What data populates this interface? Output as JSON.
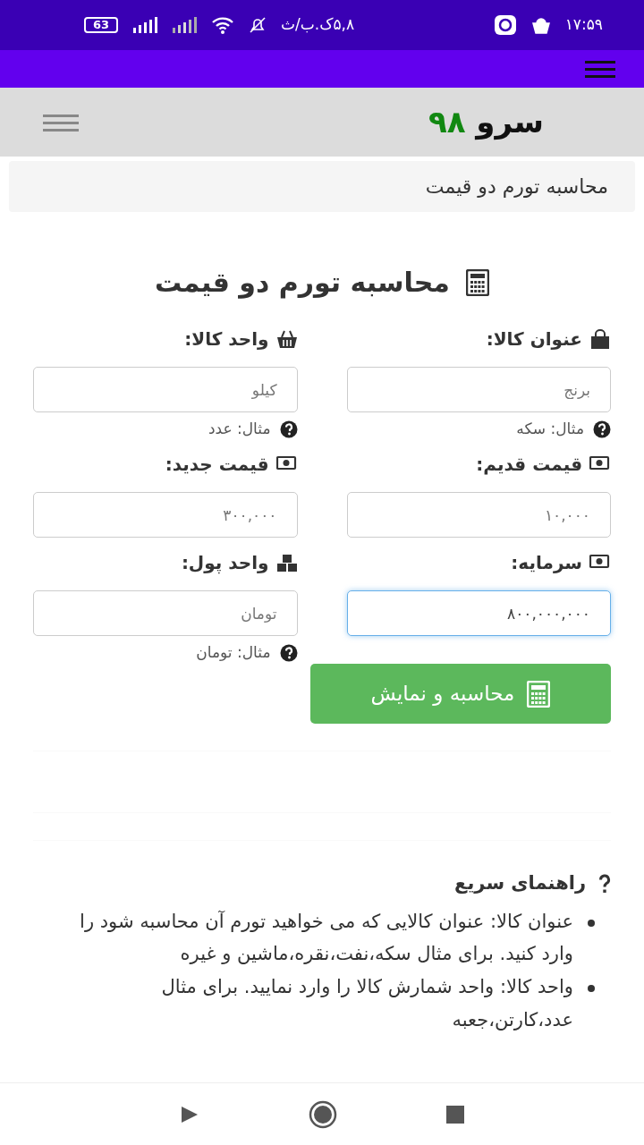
{
  "status_bar": {
    "time": "۱۷:۵۹",
    "speed": "۵,۸ک.ب/ث",
    "battery": "63"
  },
  "site_header": {
    "logo_text": "سرو",
    "logo_number": "۹۸"
  },
  "breadcrumb": "محاسبه تورم دو قیمت",
  "form": {
    "title": "محاسبه تورم دو قیمت",
    "fields": [
      {
        "label": "عنوان کالا:",
        "placeholder": "برنج",
        "hint": "مثال: سکه",
        "focused": false
      },
      {
        "label": "واحد کالا:",
        "placeholder": "کیلو",
        "hint": "مثال: عدد",
        "focused": false
      },
      {
        "label": "قیمت قدیم:",
        "placeholder": "۱۰,۰۰۰",
        "focused": false
      },
      {
        "label": "قیمت جدید:",
        "placeholder": "۳۰۰,۰۰۰",
        "focused": false
      },
      {
        "label": "سرمایه:",
        "value": "۸۰۰,۰۰۰,۰۰۰",
        "focused": true
      },
      {
        "label": "واحد پول:",
        "placeholder": "تومان",
        "hint": "مثال: تومان",
        "focused": false
      }
    ],
    "button": "محاسبه و نمایش"
  },
  "guide": {
    "title": "راهنمای سریع",
    "items": [
      "عنوان کالا: عنوان کالایی که می خواهید تورم آن محاسبه شود را وارد کنید. برای مثال سکه،نفت،نقره،ماشین و غیره",
      "واحد کالا: واحد شمارش کالا را وارد نمایید. برای مثال عدد،کارتن،جعبه"
    ]
  }
}
